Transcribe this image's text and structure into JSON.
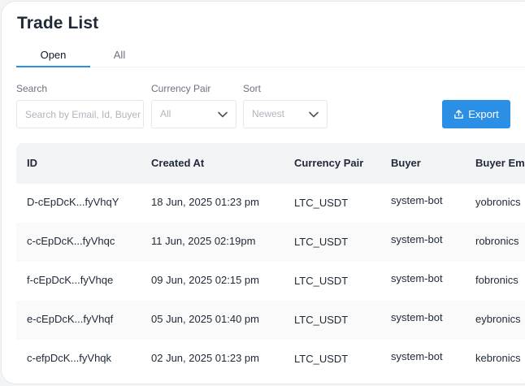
{
  "page": {
    "title": "Trade List"
  },
  "tabs": [
    {
      "label": "Open",
      "active": true
    },
    {
      "label": "All",
      "active": false
    }
  ],
  "filters": {
    "search": {
      "label": "Search",
      "placeholder": "Search by Email, Id, Buyer"
    },
    "currency_pair": {
      "label": "Currency Pair",
      "value": "All"
    },
    "sort": {
      "label": "Sort",
      "value": "Newest"
    }
  },
  "toolbar": {
    "export_label": "Export",
    "accent": "#2b8fe6"
  },
  "table": {
    "columns": [
      "ID",
      "Created At",
      "Currency Pair",
      "Buyer",
      "Buyer Em"
    ],
    "rows": [
      [
        "D-cEpDcK...fyVhqY",
        "18 Jun, 2025 01:23 pm",
        "LTC_USDT",
        "system-bot",
        "yobronics"
      ],
      [
        "c-cEpDcK...fyVhqc",
        "11 Jun, 2025 02:19pm",
        "LTC_USDT",
        "system-bot",
        "robronics"
      ],
      [
        "f-cEpDcK...fyVhqe",
        "09 Jun, 2025 02:15 pm",
        "LTC_USDT",
        "system-bot",
        "fobronics"
      ],
      [
        "e-cEpDcK...fyVhqf",
        "05 Jun, 2025 01:40 pm",
        "LTC_USDT",
        "system-bot",
        "eybronics"
      ],
      [
        "c-efpDcK...fyVhqk",
        "02 Jun, 2025 01:23 pm",
        "LTC_USDT",
        "system-bot",
        "kebronics"
      ]
    ]
  }
}
